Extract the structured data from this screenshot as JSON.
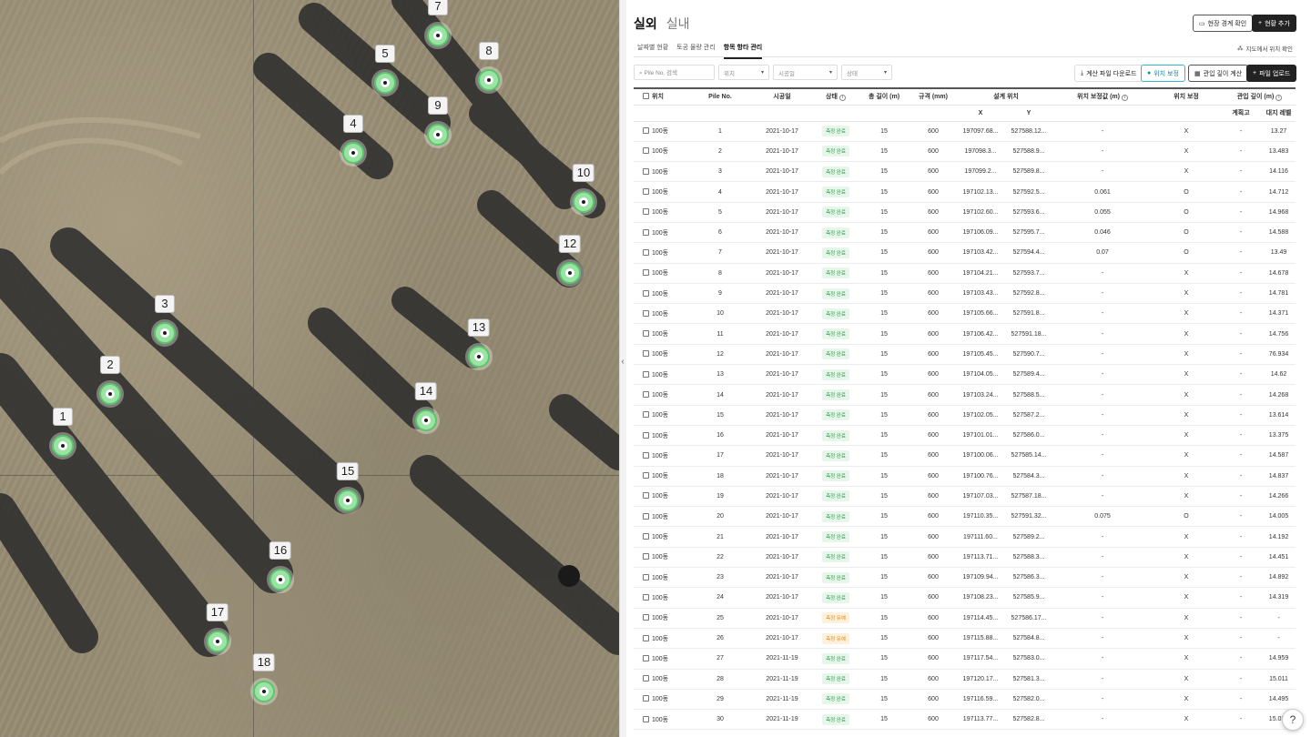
{
  "map": {
    "pins": [
      {
        "label": "1"
      },
      {
        "label": "2"
      },
      {
        "label": "3"
      },
      {
        "label": "4"
      },
      {
        "label": "5"
      },
      {
        "label": "7"
      },
      {
        "label": "8"
      },
      {
        "label": "9"
      },
      {
        "label": "10"
      },
      {
        "label": "12"
      },
      {
        "label": "13"
      },
      {
        "label": "14"
      },
      {
        "label": "15"
      },
      {
        "label": "16"
      },
      {
        "label": "17"
      },
      {
        "label": "18"
      }
    ]
  },
  "header": {
    "tab_outdoor": "실외",
    "tab_indoor": "실내",
    "btn_boundary": "현장 경계 확인",
    "btn_add": "현황 추가"
  },
  "subtabs": {
    "t1": "날짜별 현황",
    "t2": "토공 물량 관리",
    "t3": "항목 항타 관리"
  },
  "map_check": "지도에서 위치 확인",
  "filters": {
    "search_placeholder": "Pile No. 검색",
    "f1": "위치",
    "f2": "시공일",
    "f3": "상태"
  },
  "actions": {
    "download": "계산 파일 다운로드",
    "correct": "위치 보정",
    "depth": "관입 깊이 계산",
    "upload": "파일 업로드"
  },
  "table": {
    "headers": {
      "loc": "위치",
      "pile": "Pile No.",
      "date": "시공일",
      "status": "상태",
      "len": "총 길이 (m)",
      "spec": "규격 (mm)",
      "design": "설계 위치",
      "corr_val": "위치 보정값 (m)",
      "corr": "위치 보정",
      "depth": "관입 깊이 (m)",
      "x": "X",
      "y": "Y",
      "plan": "계획고",
      "ground": "대지 레벨"
    },
    "rows": [
      [
        "100동",
        "1",
        "2021-10-17",
        "측정 완료",
        "15",
        "600",
        "197097.68...",
        "527588.12...",
        "-",
        "X",
        "-",
        "13.27"
      ],
      [
        "100동",
        "2",
        "2021-10-17",
        "측정 완료",
        "15",
        "600",
        "197098.3...",
        "527588.9...",
        "-",
        "X",
        "-",
        "13.483"
      ],
      [
        "100동",
        "3",
        "2021-10-17",
        "측정 완료",
        "15",
        "600",
        "197099.2...",
        "527589.8...",
        "-",
        "X",
        "-",
        "14.116"
      ],
      [
        "100동",
        "4",
        "2021-10-17",
        "측정 완료",
        "15",
        "600",
        "197102.13...",
        "527592.5...",
        "0.061",
        "O",
        "-",
        "14.712"
      ],
      [
        "100동",
        "5",
        "2021-10-17",
        "측정 완료",
        "15",
        "600",
        "197102.60...",
        "527593.6...",
        "0.055",
        "O",
        "-",
        "14.968"
      ],
      [
        "100동",
        "6",
        "2021-10-17",
        "측정 완료",
        "15",
        "600",
        "197106.09...",
        "527595.7...",
        "0.046",
        "O",
        "-",
        "14.588"
      ],
      [
        "100동",
        "7",
        "2021-10-17",
        "측정 완료",
        "15",
        "600",
        "197103.42...",
        "527594.4...",
        "0.07",
        "O",
        "-",
        "13.49"
      ],
      [
        "100동",
        "8",
        "2021-10-17",
        "측정 완료",
        "15",
        "600",
        "197104.21...",
        "527593.7...",
        "-",
        "X",
        "-",
        "14.678"
      ],
      [
        "100동",
        "9",
        "2021-10-17",
        "측정 완료",
        "15",
        "600",
        "197103.43...",
        "527592.8...",
        "-",
        "X",
        "-",
        "14.781"
      ],
      [
        "100동",
        "10",
        "2021-10-17",
        "측정 완료",
        "15",
        "600",
        "197105.66...",
        "527591.8...",
        "-",
        "X",
        "-",
        "14.371"
      ],
      [
        "100동",
        "11",
        "2021-10-17",
        "측정 완료",
        "15",
        "600",
        "197106.42...",
        "527591.18...",
        "-",
        "X",
        "-",
        "14.756"
      ],
      [
        "100동",
        "12",
        "2021-10-17",
        "측정 완료",
        "15",
        "600",
        "197105.45...",
        "527590.7...",
        "-",
        "X",
        "-",
        "76.934"
      ],
      [
        "100동",
        "13",
        "2021-10-17",
        "측정 완료",
        "15",
        "600",
        "197104.05...",
        "527589.4...",
        "-",
        "X",
        "-",
        "14.62"
      ],
      [
        "100동",
        "14",
        "2021-10-17",
        "측정 완료",
        "15",
        "600",
        "197103.24...",
        "527588.5...",
        "-",
        "X",
        "-",
        "14.268"
      ],
      [
        "100동",
        "15",
        "2021-10-17",
        "측정 완료",
        "15",
        "600",
        "197102.05...",
        "527587.2...",
        "-",
        "X",
        "-",
        "13.614"
      ],
      [
        "100동",
        "16",
        "2021-10-17",
        "측정 완료",
        "15",
        "600",
        "197101.01...",
        "527586.0...",
        "-",
        "X",
        "-",
        "13.375"
      ],
      [
        "100동",
        "17",
        "2021-10-17",
        "측정 완료",
        "15",
        "600",
        "197100.06...",
        "527585.14...",
        "-",
        "X",
        "-",
        "14.587"
      ],
      [
        "100동",
        "18",
        "2021-10-17",
        "측정 완료",
        "15",
        "600",
        "197100.76...",
        "527584.3...",
        "-",
        "X",
        "-",
        "14.837"
      ],
      [
        "100동",
        "19",
        "2021-10-17",
        "측정 완료",
        "15",
        "600",
        "197107.03...",
        "527587.18...",
        "-",
        "X",
        "-",
        "14.266"
      ],
      [
        "100동",
        "20",
        "2021-10-17",
        "측정 완료",
        "15",
        "600",
        "197110.35...",
        "527591.32...",
        "0.075",
        "O",
        "-",
        "14.005"
      ],
      [
        "100동",
        "21",
        "2021-10-17",
        "측정 완료",
        "15",
        "600",
        "197111.60...",
        "527589.2...",
        "-",
        "X",
        "-",
        "14.192"
      ],
      [
        "100동",
        "22",
        "2021-10-17",
        "측정 완료",
        "15",
        "600",
        "197113.71...",
        "527588.3...",
        "-",
        "X",
        "-",
        "14.451"
      ],
      [
        "100동",
        "23",
        "2021-10-17",
        "측정 완료",
        "15",
        "600",
        "197109.94...",
        "527586.3...",
        "-",
        "X",
        "-",
        "14.892"
      ],
      [
        "100동",
        "24",
        "2021-10-17",
        "측정 완료",
        "15",
        "600",
        "197108.23...",
        "527585.9...",
        "-",
        "X",
        "-",
        "14.319"
      ],
      [
        "100동",
        "25",
        "2021-10-17",
        "측정 유예",
        "15",
        "600",
        "197114.45...",
        "527586.17...",
        "-",
        "X",
        "-",
        "-"
      ],
      [
        "100동",
        "26",
        "2021-10-17",
        "측정 유예",
        "15",
        "600",
        "197115.88...",
        "527584.8...",
        "-",
        "X",
        "-",
        "-"
      ],
      [
        "100동",
        "27",
        "2021-11-19",
        "측정 완료",
        "15",
        "600",
        "197117.54...",
        "527583.0...",
        "-",
        "X",
        "-",
        "14.959"
      ],
      [
        "100동",
        "28",
        "2021-11-19",
        "측정 완료",
        "15",
        "600",
        "197120.17...",
        "527581.3...",
        "-",
        "X",
        "-",
        "15.011"
      ],
      [
        "100동",
        "29",
        "2021-11-19",
        "측정 완료",
        "15",
        "600",
        "197116.59...",
        "527582.0...",
        "-",
        "X",
        "-",
        "14.495"
      ],
      [
        "100동",
        "30",
        "2021-11-19",
        "측정 완료",
        "15",
        "600",
        "197113.77...",
        "527582.8...",
        "-",
        "X",
        "-",
        "15.036"
      ]
    ]
  },
  "colors": {
    "accent": "#222222",
    "done_badge": "#2e9a45",
    "hold_badge": "#d98a12",
    "marker": "#5ac66a",
    "teal": "#35b7c9"
  },
  "help": "?"
}
